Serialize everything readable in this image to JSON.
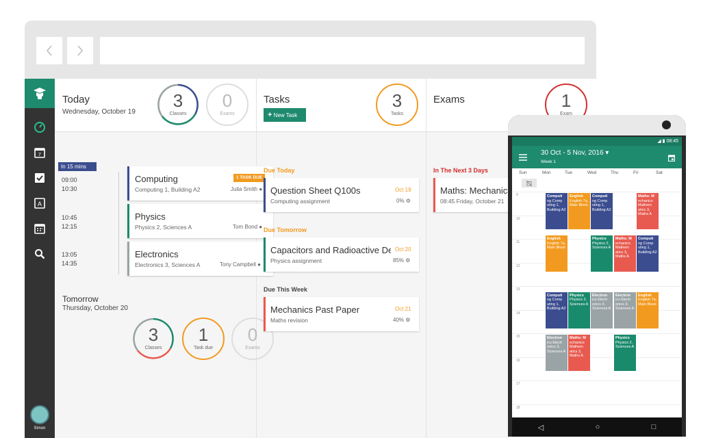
{
  "colors": {
    "green": "#1e8a6e",
    "navy": "#3b4d8f",
    "teal": "#1a8a6c",
    "red": "#e85a4f",
    "orange": "#f29a1f",
    "gray": "#9aa3a5"
  },
  "today": {
    "title": "Today",
    "date": "Wednesday, October 19",
    "classes_count": "3",
    "classes_label": "Classes",
    "exams_count": "0",
    "exams_label": "Exams"
  },
  "timeline_badge": "In 15 mins",
  "classes": [
    {
      "start": "09:00",
      "end": "10:30",
      "subject": "Computing",
      "detail": "Computing 1, Building A2",
      "teacher": "Julia Smith",
      "badge": "1 TASK DUE"
    },
    {
      "start": "10:45",
      "end": "12:15",
      "subject": "Physics",
      "detail": "Physics 2, Sciences A",
      "teacher": "Tom Bond"
    },
    {
      "start": "13:05",
      "end": "14:35",
      "subject": "Electronics",
      "detail": "Electronics 3, Sciences A",
      "teacher": "Tony Campbell"
    }
  ],
  "tomorrow": {
    "title": "Tomorrow",
    "date": "Thursday, October 20",
    "classes_count": "3",
    "classes_label": "Classes",
    "task_count": "1",
    "task_label": "Task due",
    "exams_count": "0",
    "exams_label": "Exams"
  },
  "tasks": {
    "title": "Tasks",
    "new_label": "New Task",
    "count": "3",
    "count_label": "Tasks",
    "groups": [
      {
        "label": "Due Today",
        "title": "Question Sheet Q100s",
        "detail": "Computing assignment",
        "date": "Oct 19",
        "progress": "0%"
      },
      {
        "label": "Due Tomorrow",
        "title": "Capacitors and Radioactive Decay",
        "detail": "Physics assignment",
        "date": "Oct 20",
        "progress": "85%"
      },
      {
        "label": "Due This Week",
        "title": "Mechanics Past Paper",
        "detail": "Maths revision",
        "date": "Oct 21",
        "progress": "40%"
      }
    ]
  },
  "exams": {
    "title": "Exams",
    "count": "1",
    "count_label": "Exam",
    "group_label": "In The Next 3 Days",
    "item_title": "Maths: Mechanics",
    "item_detail": "08:45 Friday, October 21"
  },
  "user": {
    "name": "Simon"
  },
  "phone": {
    "time": "08:45",
    "range": "30 Oct - 5 Nov, 2016",
    "week": "Week 1",
    "days": [
      "Sun",
      "Mon",
      "Tue",
      "Wed",
      "Thu",
      "Fri",
      "Sat"
    ],
    "hours": [
      "9",
      "10",
      "11",
      "12",
      "13",
      "14",
      "15",
      "16",
      "17",
      "18"
    ],
    "events": [
      {
        "day": 1,
        "row": 0,
        "span": 1.6,
        "color": "navy",
        "title": "Computi",
        "body": "ng Comp uting 1, Building A2"
      },
      {
        "day": 2,
        "row": 0,
        "span": 1.6,
        "color": "orange",
        "title": "English",
        "body": "English 7a, Main Block"
      },
      {
        "day": 3,
        "row": 0,
        "span": 1.6,
        "color": "navy",
        "title": "Computi",
        "body": "ng Comp uting 1, Building A2"
      },
      {
        "day": 5,
        "row": 0,
        "span": 1.6,
        "color": "red",
        "title": "Maths: M",
        "body": "echanics Mathem atics 3, Maths A"
      },
      {
        "day": 1,
        "row": 1.8,
        "span": 1.6,
        "color": "orange",
        "title": "English",
        "body": "English 7a, Main Block"
      },
      {
        "day": 3,
        "row": 1.8,
        "span": 1.6,
        "color": "teal",
        "title": "Physics",
        "body": "Physics 2, Sciences A"
      },
      {
        "day": 4,
        "row": 1.8,
        "span": 1.6,
        "color": "red",
        "title": "Maths: M",
        "body": "echanics Mathem atics 3, Maths A"
      },
      {
        "day": 5,
        "row": 1.8,
        "span": 1.6,
        "color": "navy",
        "title": "Computi",
        "body": "ng Comp uting 1, Building A2"
      },
      {
        "day": 1,
        "row": 4.2,
        "span": 1.6,
        "color": "navy",
        "title": "Computi",
        "body": "ng Comp uting 1, Building A2"
      },
      {
        "day": 2,
        "row": 4.2,
        "span": 1.6,
        "color": "teal",
        "title": "Physics",
        "body": "Physics 2, Sciences A"
      },
      {
        "day": 3,
        "row": 4.2,
        "span": 1.6,
        "color": "gray",
        "title": "Electron",
        "body": "ics Electr onics 3, Sciences A"
      },
      {
        "day": 4,
        "row": 4.2,
        "span": 1.6,
        "color": "gray",
        "title": "Electron",
        "body": "ics Electr onics 3, Sciences A"
      },
      {
        "day": 5,
        "row": 4.2,
        "span": 1.6,
        "color": "orange",
        "title": "English",
        "body": "English 7a, Main Block"
      },
      {
        "day": 1,
        "row": 6,
        "span": 1.6,
        "color": "gray",
        "title": "Electron",
        "body": "ics Electr onics 3, Sciences A"
      },
      {
        "day": 2,
        "row": 6,
        "span": 1.6,
        "color": "red",
        "title": "Maths: M",
        "body": "echanics Mathem atics 3, Maths A"
      },
      {
        "day": 4,
        "row": 6,
        "span": 1.6,
        "color": "teal",
        "title": "Physics",
        "body": "Physics 2, Sciences A"
      }
    ]
  }
}
